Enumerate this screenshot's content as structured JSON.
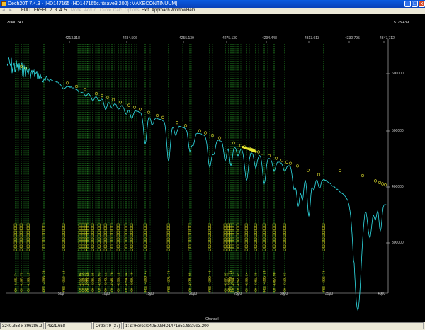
{
  "window": {
    "title": "Dech20T 7.4.3 - [HD147165   (HD147165c.fitsave3.200) :MAKECONTINUUM]",
    "min_glyph": "_",
    "max_glyph": "□",
    "close_glyph": "x"
  },
  "menu": {
    "items": [
      {
        "label": "FULL",
        "enabled": true
      },
      {
        "label": "FREE",
        "enabled": true
      },
      {
        "label": "1",
        "enabled": true
      },
      {
        "label": "2",
        "enabled": true
      },
      {
        "label": "3",
        "enabled": true
      },
      {
        "label": "4",
        "enabled": true
      },
      {
        "label": "5",
        "enabled": true
      },
      {
        "label": "Mode",
        "enabled": false
      },
      {
        "label": "AddTo",
        "enabled": false
      },
      {
        "label": "Curve",
        "enabled": false
      },
      {
        "label": "Calc",
        "enabled": false
      },
      {
        "label": "Options",
        "enabled": false
      },
      {
        "label": "Exit",
        "enabled": true
      },
      {
        "label": "Approach",
        "enabled": true
      },
      {
        "label": "Window",
        "enabled": true
      },
      {
        "label": "Help",
        "enabled": true
      }
    ]
  },
  "plot": {
    "top_left_value": "-5980.241",
    "top_right_value": "5175.439",
    "wavelength_ticks": [
      "4213.318",
      "4234.506",
      "4255.139",
      "4275.139",
      "4294.448",
      "4313.013",
      "4330.795",
      "4347.712"
    ],
    "y_tick_labels": [
      "600000",
      "500000",
      "400000",
      "300000"
    ],
    "x_tick_labels": [
      "500",
      "1000",
      "1500",
      "2000",
      "2500",
      "3000",
      "3500",
      "4000"
    ],
    "x_axis_title": "Channel",
    "colors": {
      "spectrum": "#30e0e8",
      "continuum_points": "#e8e830",
      "line_markers": "#38d838",
      "line_labels": "#e8e820",
      "axis": "#c8c8c8"
    },
    "line_ids": [
      {
        "label": "OH 4195.74"
      },
      {
        "label": "CH 4197.79"
      },
      {
        "label": "CH 4198.17"
      },
      {
        "label": "FEI 4206.70"
      },
      {
        "label": "FEI 4216.18"
      },
      {
        "label": "CH 4227.04"
      },
      {
        "label": "CH 4228.35"
      },
      {
        "label": "CH 4229.82"
      },
      {
        "label": "CH 4233.60"
      },
      {
        "label": "CH 4236.25"
      },
      {
        "label": "CH 4239.93"
      },
      {
        "label": "CH 4242.11"
      },
      {
        "label": "CH 4246.70"
      },
      {
        "label": "CH 4250.12"
      },
      {
        "label": "CH 4254.34"
      },
      {
        "label": "CH 4258.40"
      },
      {
        "label": "FEI 4260.47"
      },
      {
        "label": "FEI 4271.76"
      },
      {
        "label": "CH 4278.99"
      },
      {
        "label": "FEI 4282.40"
      },
      {
        "label": "CH 4287.37"
      },
      {
        "label": "CH 4289.72"
      },
      {
        "label": "FEI 4291.46"
      },
      {
        "label": "CH 4294.13"
      },
      {
        "label": "CH 4297.41"
      },
      {
        "label": "CH 4299.24"
      },
      {
        "label": "CH 4301.39"
      },
      {
        "label": "FEI 4305.26"
      },
      {
        "label": "CH 4307.90"
      },
      {
        "label": "CH 4313.63"
      },
      {
        "label": "FEI 4325.76"
      }
    ]
  },
  "status": {
    "cursor": "3240.353 x 396386.2",
    "wavelength": "4321.658",
    "order": "Order: 9 (37)",
    "file": "1: d:\\Feros\\040502\\HD147165c.fitsave3.200"
  }
}
